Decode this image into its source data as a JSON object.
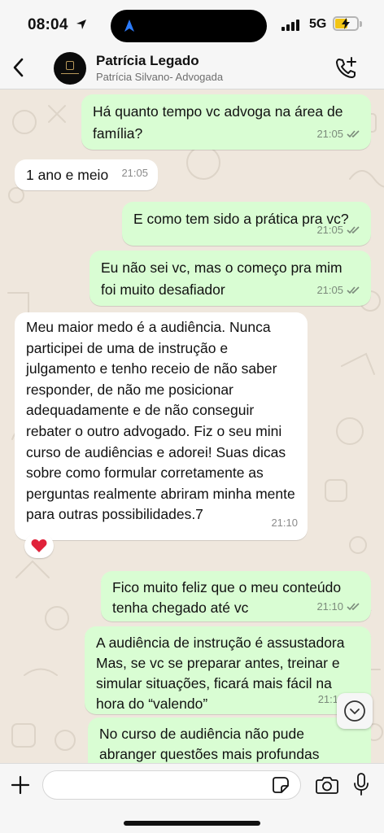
{
  "status_bar": {
    "time": "08:04",
    "network": "5G"
  },
  "header": {
    "contact_name": "Patrícia Legado",
    "contact_subtitle": "Patrícia Silvano- Advogada",
    "icons": {
      "back": "chevron-left-icon",
      "call": "add-call-icon"
    }
  },
  "messages": [
    {
      "direction": "out",
      "text": "Há quanto tempo vc advoga na área de família?",
      "time": "21:05",
      "status": "read"
    },
    {
      "direction": "in",
      "text": "1 ano e meio",
      "time": "21:05"
    },
    {
      "direction": "out",
      "text": "E como tem sido a prática pra vc?",
      "time": "21:05",
      "status": "read"
    },
    {
      "direction": "out",
      "text": "Eu não sei vc, mas o começo pra mim foi muito desafiador",
      "time": "21:05",
      "status": "read"
    },
    {
      "direction": "in",
      "text": "Meu maior medo é a audiência. Nunca participei de uma de instrução e julgamento e tenho receio de não saber responder, de não me posicionar adequadamente e de não conseguir rebater o outro advogado. Fiz o seu mini curso de audiências e adorei! Suas dicas sobre como formular corretamente as perguntas realmente abriram minha mente para outras possibilidades.7",
      "time": "21:10",
      "reaction": "❤️"
    },
    {
      "direction": "out",
      "text": "Fico muito feliz que o meu conteúdo tenha chegado até vc",
      "time": "21:10",
      "status": "read"
    },
    {
      "direction": "out",
      "text": "A audiência de instrução é assustadora Mas, se vc se preparar antes, treinar e simular situações, ficará mais fácil na hora do “valendo”",
      "time": "21:1"
    },
    {
      "direction": "out",
      "text": "No curso de audiência não pude abranger questões mais profundas",
      "time": ""
    }
  ],
  "input": {
    "placeholder": ""
  },
  "colors": {
    "outgoing_bubble": "#d9fdd3",
    "incoming_bubble": "#ffffff",
    "read_ticks": "#7b8a7b",
    "wallpaper": "#efe7dd",
    "battery": "#f2c515",
    "accent": "#2b7cff"
  },
  "battery_level": 0.55
}
